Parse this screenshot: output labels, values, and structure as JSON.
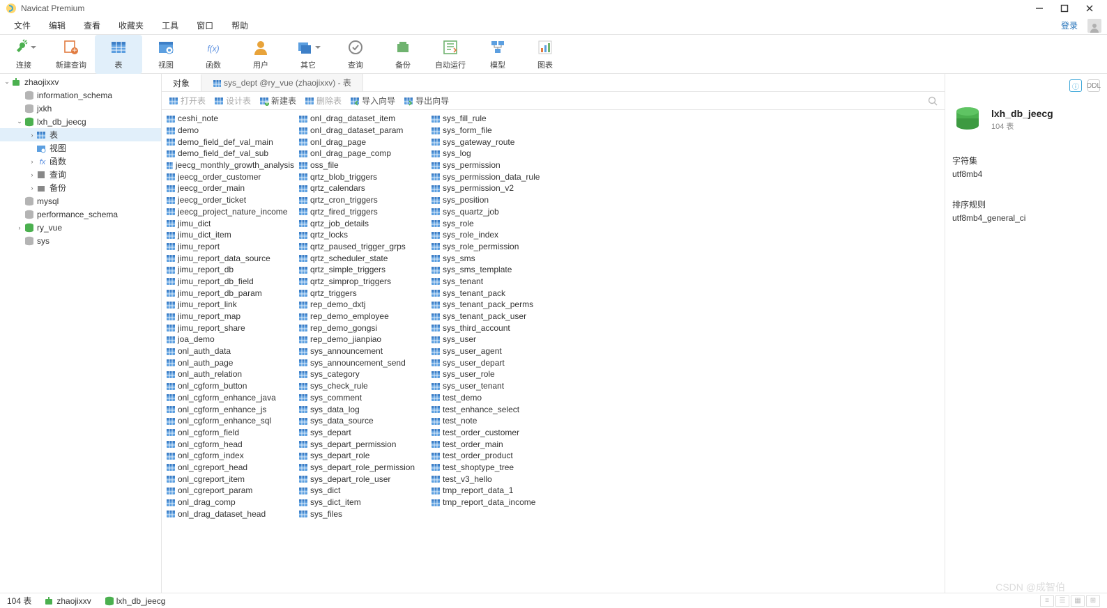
{
  "app": {
    "title": "Navicat Premium"
  },
  "menu": {
    "items": [
      "文件",
      "编辑",
      "查看",
      "收藏夹",
      "工具",
      "窗口",
      "帮助"
    ],
    "login": "登录"
  },
  "toolbar": [
    {
      "name": "connection",
      "label": "连接",
      "color": "#4bb04f",
      "hasDrop": true
    },
    {
      "name": "new-query",
      "label": "新建查询",
      "color": "#e17b40"
    },
    {
      "name": "table",
      "label": "表",
      "color": "#5c9fe0",
      "active": true
    },
    {
      "name": "view",
      "label": "视图",
      "color": "#5c9fe0"
    },
    {
      "name": "function",
      "label": "函数",
      "color": "#5b8fe0",
      "text": "f(x)"
    },
    {
      "name": "user",
      "label": "用户",
      "color": "#e8a33a"
    },
    {
      "name": "other",
      "label": "其它",
      "color": "#5c9fe0",
      "hasDrop": true
    },
    {
      "name": "query",
      "label": "查询",
      "color": "#888"
    },
    {
      "name": "backup",
      "label": "备份",
      "color": "#6fb36f"
    },
    {
      "name": "auto-run",
      "label": "自动运行",
      "color": "#6fb36f"
    },
    {
      "name": "model",
      "label": "模型",
      "color": "#5c9fe0"
    },
    {
      "name": "chart",
      "label": "图表",
      "color": "#e17b40"
    }
  ],
  "tree": [
    {
      "type": "conn",
      "label": "zhaojixxv",
      "expanded": true,
      "depth": 0,
      "children": [
        {
          "type": "db",
          "label": "information_schema",
          "depth": 1,
          "state": "gray"
        },
        {
          "type": "db",
          "label": "jxkh",
          "depth": 1,
          "state": "gray"
        },
        {
          "type": "db",
          "label": "lxh_db_jeecg",
          "depth": 1,
          "state": "green",
          "expanded": true,
          "children": [
            {
              "type": "table",
              "label": "表",
              "depth": 2,
              "hasArrow": true,
              "sel": true
            },
            {
              "type": "view",
              "label": "视图",
              "depth": 2
            },
            {
              "type": "fx",
              "label": "函数",
              "depth": 2,
              "hasArrow": true
            },
            {
              "type": "query",
              "label": "查询",
              "depth": 2,
              "hasArrow": true
            },
            {
              "type": "backup",
              "label": "备份",
              "depth": 2,
              "hasArrow": true
            }
          ]
        },
        {
          "type": "db",
          "label": "mysql",
          "depth": 1,
          "state": "gray"
        },
        {
          "type": "db",
          "label": "performance_schema",
          "depth": 1,
          "state": "gray"
        },
        {
          "type": "db",
          "label": "ry_vue",
          "depth": 1,
          "state": "green",
          "hasArrow": true
        },
        {
          "type": "db",
          "label": "sys",
          "depth": 1,
          "state": "gray"
        }
      ]
    }
  ],
  "tabs": [
    {
      "name": "objects",
      "label": "对象",
      "active": true
    },
    {
      "name": "sys-dept",
      "label": "sys_dept @ry_vue (zhaojixxv) - 表",
      "icon": "table"
    }
  ],
  "secToolbar": {
    "open": "打开表",
    "design": "设计表",
    "new": "新建表",
    "delete": "删除表",
    "import": "导入向导",
    "export": "导出向导"
  },
  "tables": [
    "ceshi_note",
    "demo",
    "demo_field_def_val_main",
    "demo_field_def_val_sub",
    "jeecg_monthly_growth_analysis",
    "jeecg_order_customer",
    "jeecg_order_main",
    "jeecg_order_ticket",
    "jeecg_project_nature_income",
    "jimu_dict",
    "jimu_dict_item",
    "jimu_report",
    "jimu_report_data_source",
    "jimu_report_db",
    "jimu_report_db_field",
    "jimu_report_db_param",
    "jimu_report_link",
    "jimu_report_map",
    "jimu_report_share",
    "joa_demo",
    "onl_auth_data",
    "onl_auth_page",
    "onl_auth_relation",
    "onl_cgform_button",
    "onl_cgform_enhance_java",
    "onl_cgform_enhance_js",
    "onl_cgform_enhance_sql",
    "onl_cgform_field",
    "onl_cgform_head",
    "onl_cgform_index",
    "onl_cgreport_head",
    "onl_cgreport_item",
    "onl_cgreport_param",
    "onl_drag_comp",
    "onl_drag_dataset_head",
    "onl_drag_dataset_item",
    "onl_drag_dataset_param",
    "onl_drag_page",
    "onl_drag_page_comp",
    "oss_file",
    "qrtz_blob_triggers",
    "qrtz_calendars",
    "qrtz_cron_triggers",
    "qrtz_fired_triggers",
    "qrtz_job_details",
    "qrtz_locks",
    "qrtz_paused_trigger_grps",
    "qrtz_scheduler_state",
    "qrtz_simple_triggers",
    "qrtz_simprop_triggers",
    "qrtz_triggers",
    "rep_demo_dxtj",
    "rep_demo_employee",
    "rep_demo_gongsi",
    "rep_demo_jianpiao",
    "sys_announcement",
    "sys_announcement_send",
    "sys_category",
    "sys_check_rule",
    "sys_comment",
    "sys_data_log",
    "sys_data_source",
    "sys_depart",
    "sys_depart_permission",
    "sys_depart_role",
    "sys_depart_role_permission",
    "sys_depart_role_user",
    "sys_dict",
    "sys_dict_item",
    "sys_files",
    "sys_fill_rule",
    "sys_form_file",
    "sys_gateway_route",
    "sys_log",
    "sys_permission",
    "sys_permission_data_rule",
    "sys_permission_v2",
    "sys_position",
    "sys_quartz_job",
    "sys_role",
    "sys_role_index",
    "sys_role_permission",
    "sys_sms",
    "sys_sms_template",
    "sys_tenant",
    "sys_tenant_pack",
    "sys_tenant_pack_perms",
    "sys_tenant_pack_user",
    "sys_third_account",
    "sys_user",
    "sys_user_agent",
    "sys_user_depart",
    "sys_user_role",
    "sys_user_tenant",
    "test_demo",
    "test_enhance_select",
    "test_note",
    "test_order_customer",
    "test_order_main",
    "test_order_product",
    "test_shoptype_tree",
    "test_v3_hello",
    "tmp_report_data_1",
    "tmp_report_data_income"
  ],
  "rpanel": {
    "title": "lxh_db_jeecg",
    "sub": "104 表",
    "charset_label": "字符集",
    "charset": "utf8mb4",
    "collation_label": "排序规则",
    "collation": "utf8mb4_general_ci"
  },
  "status": {
    "left": "104 表",
    "conn": "zhaojixxv",
    "db": "lxh_db_jeecg"
  },
  "watermark": "CSDN @成智伯"
}
